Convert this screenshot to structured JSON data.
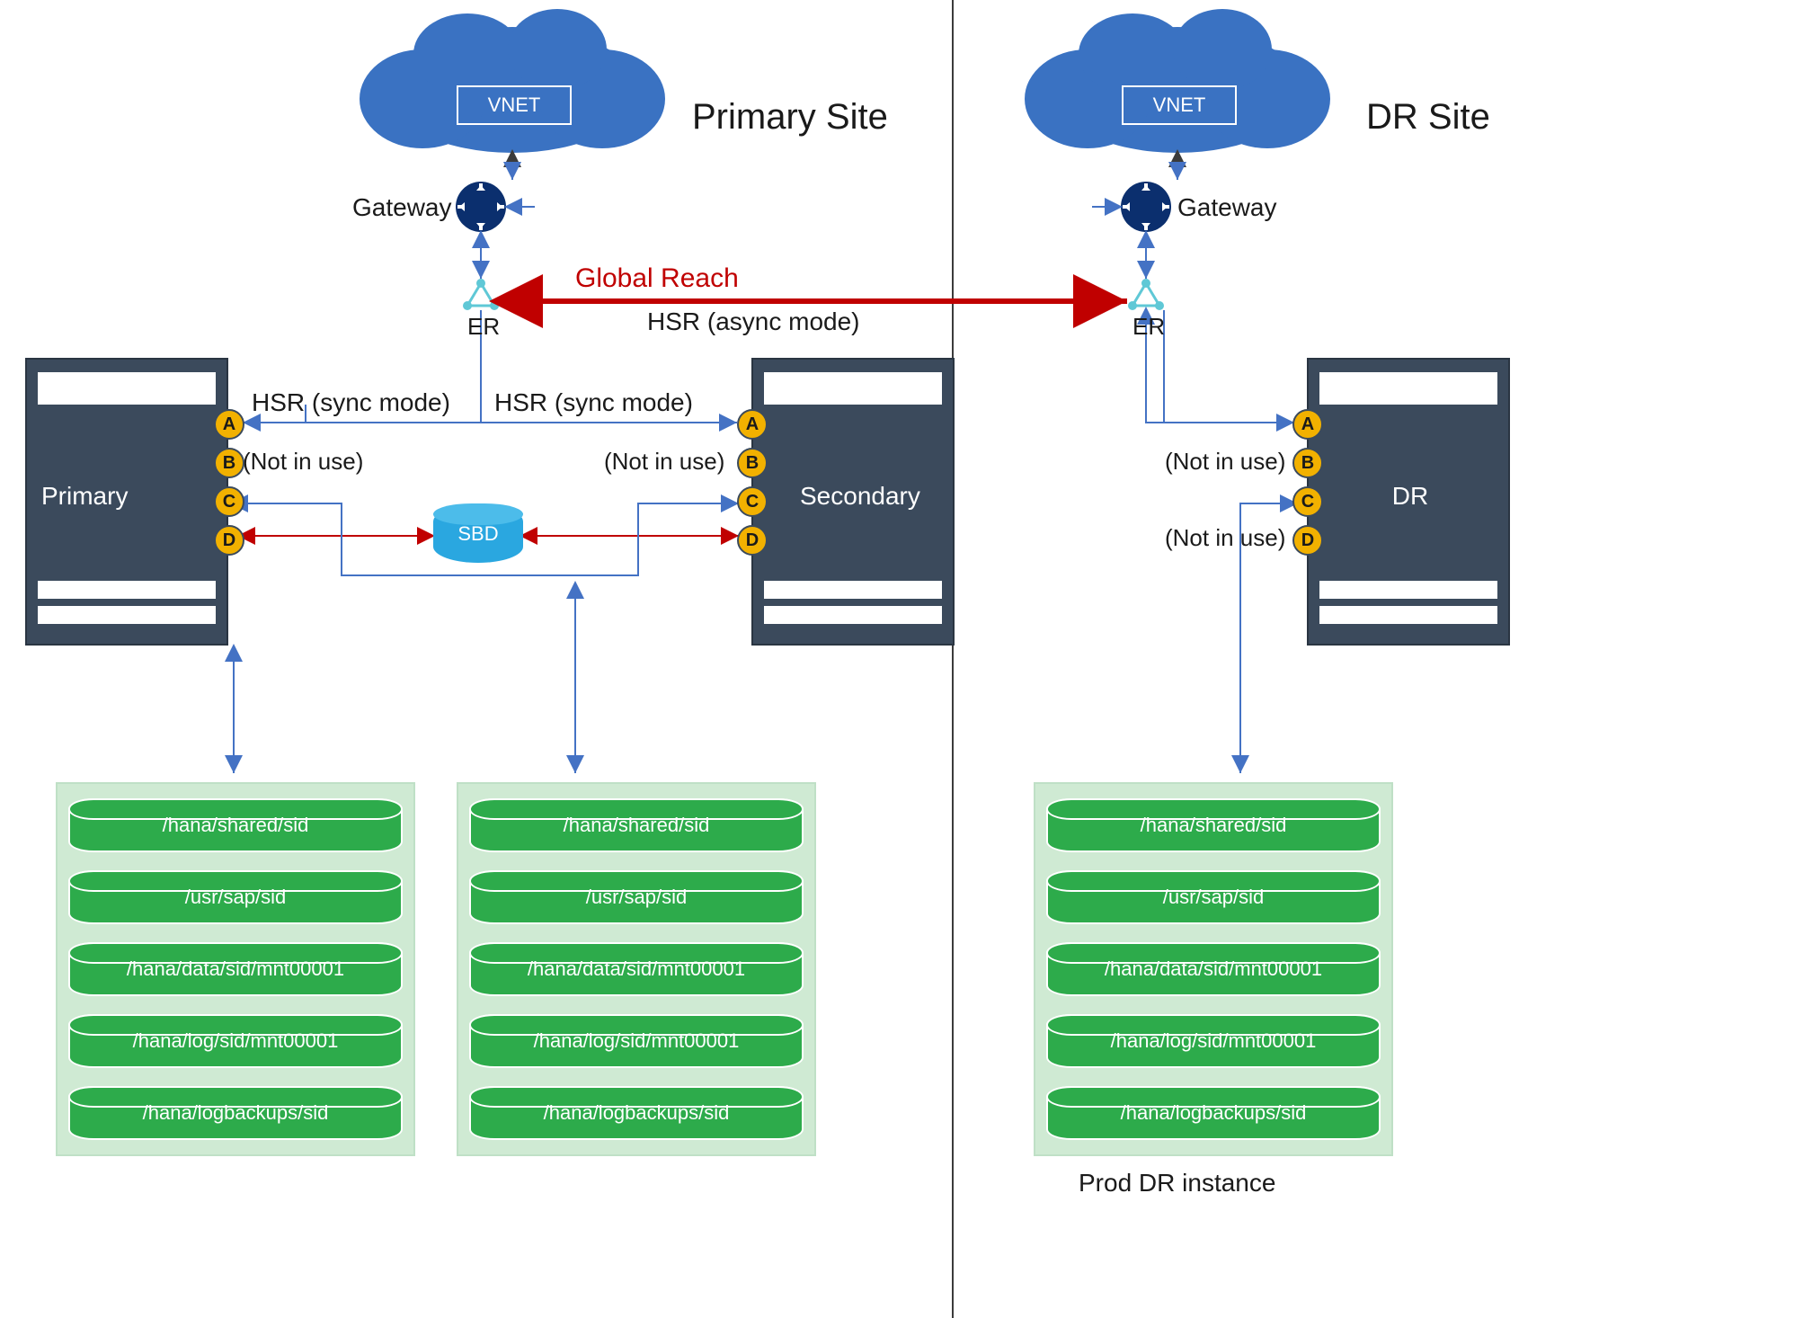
{
  "sites": {
    "primary": "Primary Site",
    "dr": "DR Site"
  },
  "vnet_label": "VNET",
  "gateway_label": "Gateway",
  "er_label": "ER",
  "global_reach": "Global Reach",
  "hsr_async": "HSR (async mode)",
  "hsr_sync": "HSR (sync mode)",
  "not_in_use": "(Not in use)",
  "sbd": "SBD",
  "servers": {
    "primary": "Primary",
    "secondary": "Secondary",
    "dr": "DR"
  },
  "ports": [
    "A",
    "B",
    "C",
    "D"
  ],
  "volumes": [
    "/hana/shared/sid",
    "/usr/sap/sid",
    "/hana/data/sid/mnt00001",
    "/hana/log/sid/mnt00001",
    "/hana/logbackups/sid"
  ],
  "footer": {
    "dr_instance": "Prod DR instance"
  },
  "colors": {
    "cloud": "#3a72c2",
    "router": "#0b2f6e",
    "er_node": "#5fc8d6",
    "red_line": "#c00000",
    "blue_line": "#4472c4",
    "black_line": "#3b3b3b"
  }
}
